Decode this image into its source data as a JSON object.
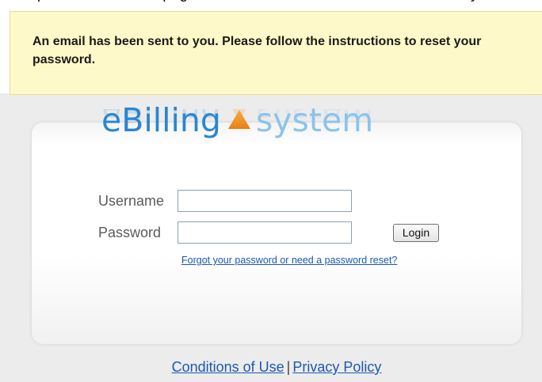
{
  "top_fragment": {
    "text": "rt password and this page will show that an email has been sent to you"
  },
  "notice": {
    "message": "An email has been sent to you. Please follow the instructions to reset your password."
  },
  "logo": {
    "brand": "eBilling",
    "product": "system"
  },
  "login_form": {
    "username_label": "Username",
    "username_value": "",
    "password_label": "Password",
    "password_value": "",
    "login_button": "Login",
    "forgot_link": "Forgot your password or need a password reset?"
  },
  "footer": {
    "conditions_link": "Conditions of Use",
    "separator": "|",
    "privacy_link": "Privacy Policy"
  },
  "colors": {
    "notice_bg": "#fef9c8",
    "brand_blue": "#2a86cf",
    "system_blue": "#8cc3ea",
    "triangle_orange": "#f08c1c",
    "link_blue": "#1c57b5"
  }
}
